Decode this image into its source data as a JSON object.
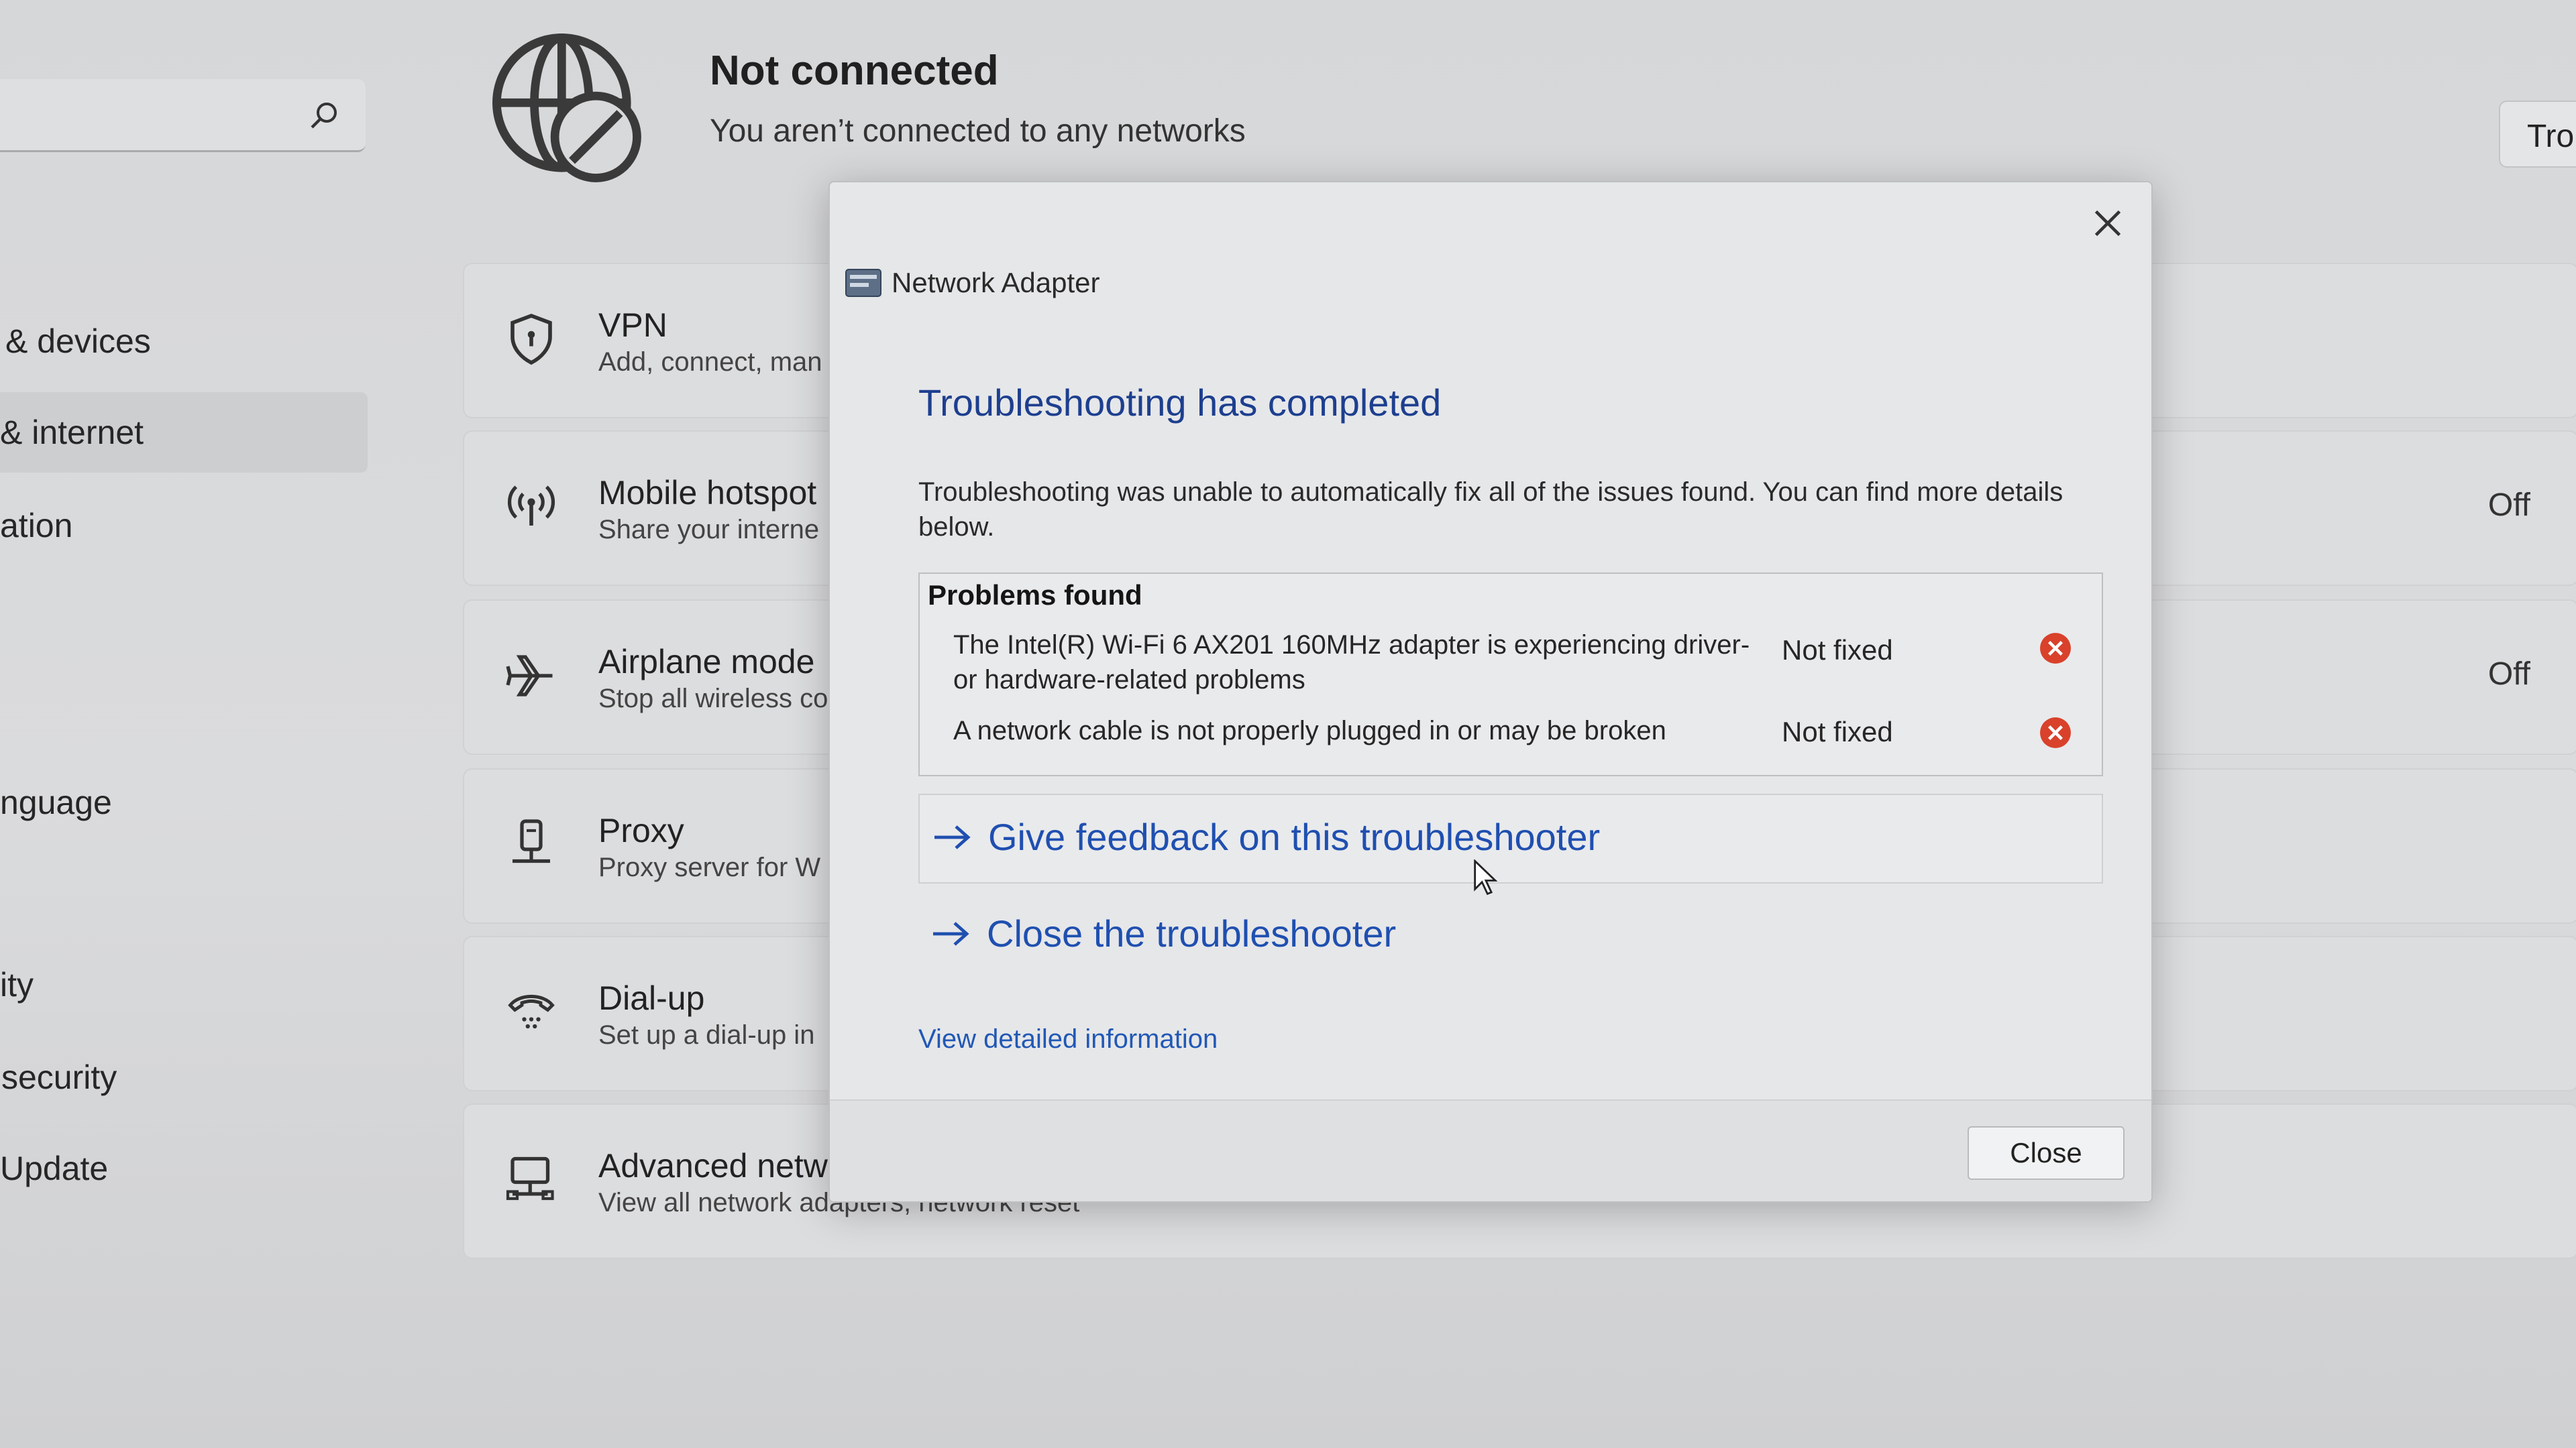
{
  "settings": {
    "nav": [
      {
        "label": "& devices"
      },
      {
        "label": "& internet",
        "active": true
      },
      {
        "label": "ation"
      },
      {
        "label": "nguage"
      },
      {
        "label": "ity"
      },
      {
        "label": "security"
      },
      {
        "label": "Update"
      }
    ],
    "status": {
      "title": "Not connected",
      "subtitle": "You aren’t connected to any networks",
      "icon": "globe-blocked-icon"
    },
    "top_right_button": "Tro",
    "rows": [
      {
        "title": "VPN",
        "subtitle": "Add, connect, man",
        "icon": "shield-icon",
        "state": ""
      },
      {
        "title": "Mobile hotspot",
        "subtitle": "Share your interne",
        "icon": "hotspot-icon",
        "state": "Off"
      },
      {
        "title": "Airplane mode",
        "subtitle": "Stop all wireless co",
        "icon": "airplane-icon",
        "state": "Off"
      },
      {
        "title": "Proxy",
        "subtitle": "Proxy server for W",
        "icon": "proxy-icon",
        "state": ""
      },
      {
        "title": "Dial-up",
        "subtitle": "Set up a dial-up in",
        "icon": "dialup-icon",
        "state": ""
      },
      {
        "title": "Advanced netwo",
        "subtitle": "View all network adapters, network reset",
        "icon": "monitor-network-icon",
        "state": ""
      }
    ]
  },
  "dialog": {
    "app_title": "Network Adapter",
    "heading": "Troubleshooting has completed",
    "description": "Troubleshooting was unable to automatically fix all of the issues found. You can find more details below.",
    "problems_header": "Problems found",
    "problems": [
      {
        "text": "The Intel(R) Wi-Fi 6 AX201 160MHz adapter is experiencing driver- or hardware-related problems",
        "status": "Not fixed"
      },
      {
        "text": "A network cable is not properly plugged in or may be broken",
        "status": "Not fixed"
      }
    ],
    "links": {
      "feedback": "Give feedback on this troubleshooter",
      "close_troubleshooter": "Close the troubleshooter",
      "details": "View detailed information"
    },
    "close_button": "Close",
    "colors": {
      "link": "#1f4fb0",
      "heading": "#1d3f8f",
      "error": "#d9412b"
    }
  }
}
